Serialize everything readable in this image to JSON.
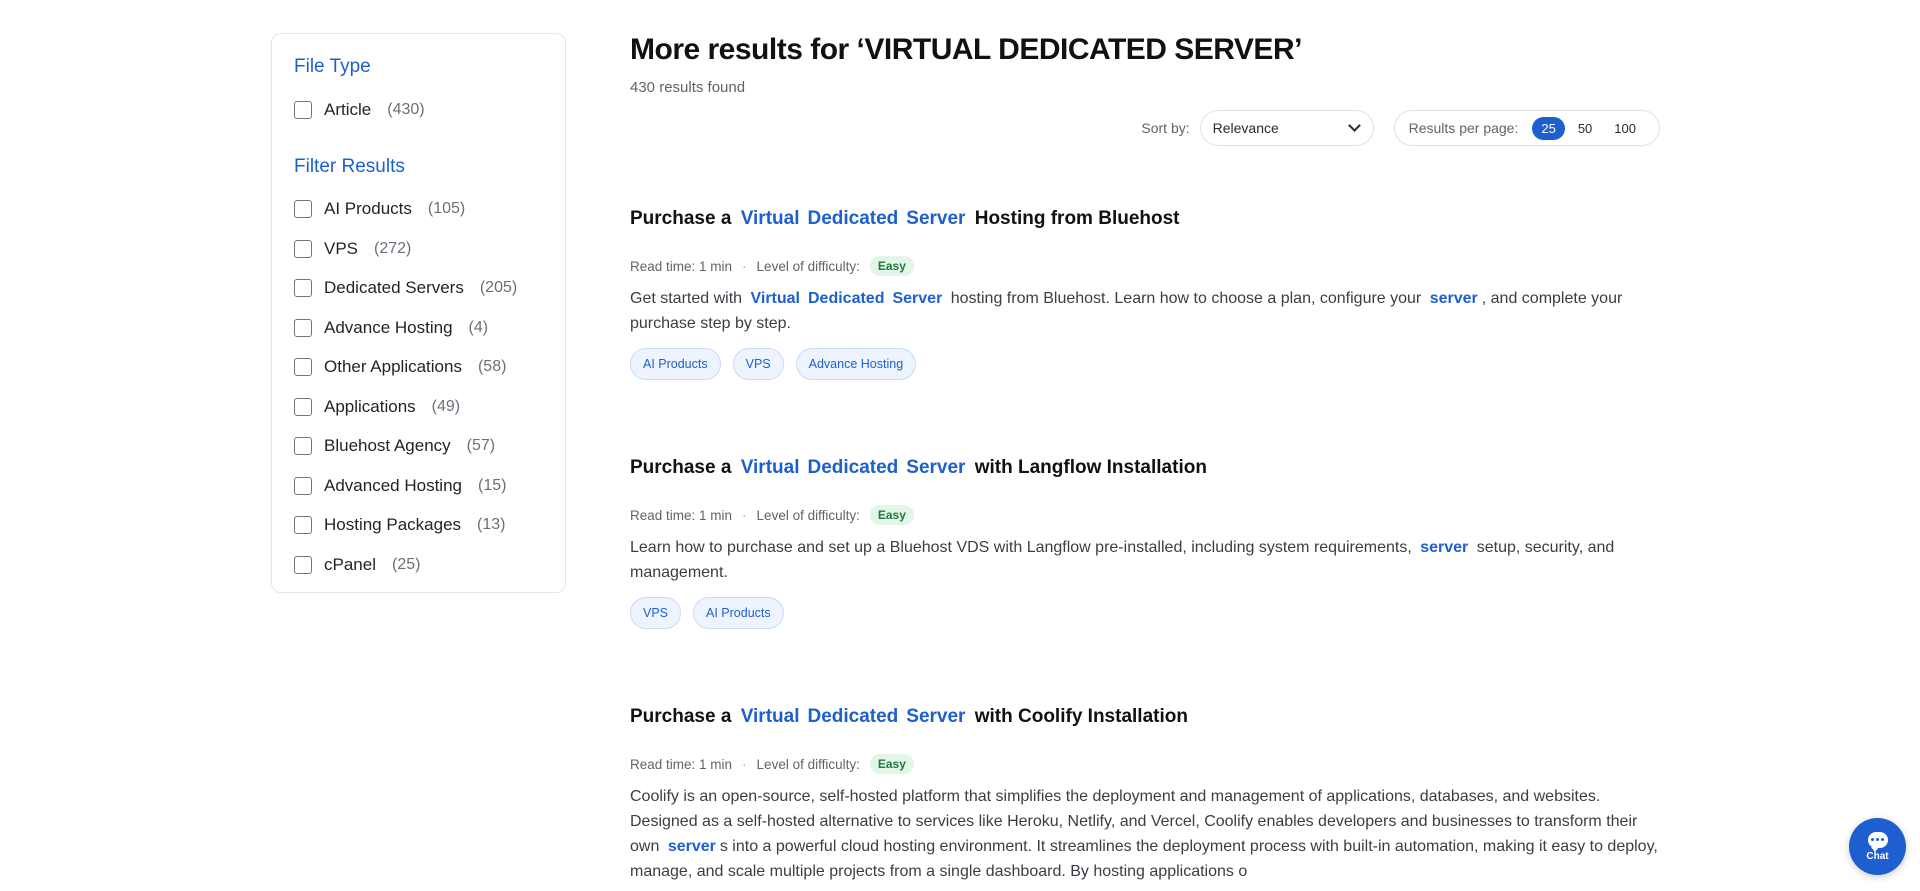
{
  "sidebar": {
    "file_type_title": "File Type",
    "file_type": [
      {
        "label": "Article",
        "count": "(430)"
      }
    ],
    "filter_title": "Filter Results",
    "filters": [
      {
        "label": "AI Products",
        "count": "(105)"
      },
      {
        "label": "VPS",
        "count": "(272)"
      },
      {
        "label": "Dedicated Servers",
        "count": "(205)"
      },
      {
        "label": "Advance Hosting",
        "count": "(4)"
      },
      {
        "label": "Other Applications",
        "count": "(58)"
      },
      {
        "label": "Applications",
        "count": "(49)"
      },
      {
        "label": "Bluehost Agency",
        "count": "(57)"
      },
      {
        "label": "Advanced Hosting",
        "count": "(15)"
      },
      {
        "label": "Hosting Packages",
        "count": "(13)"
      },
      {
        "label": "cPanel",
        "count": "(25)"
      }
    ]
  },
  "header": {
    "title": "More results for ‘VIRTUAL DEDICATED SERVER’",
    "count": "430 results found"
  },
  "controls": {
    "sort_label": "Sort by:",
    "sort_value": "Relevance",
    "per_page_label": "Results per page:",
    "per_page_options": [
      "25",
      "50",
      "100"
    ],
    "per_page_selected": "25"
  },
  "results": [
    {
      "title_prefix": "Purchase a",
      "title_hl": [
        "Virtual",
        "Dedicated",
        "Server"
      ],
      "title_suffix": "Hosting from Bluehost",
      "read_time": "Read time: 1 min",
      "difficulty_label": "Level of difficulty:",
      "difficulty": "Easy",
      "desc_1": "Get started with",
      "desc_hl": [
        "Virtual",
        "Dedicated",
        "Server"
      ],
      "desc_2": "hosting from Bluehost. Learn how to choose a plan, configure your",
      "desc_hl2": "server",
      "desc_3": ", and complete your purchase step by step.",
      "tags": [
        "AI Products",
        "VPS",
        "Advance Hosting"
      ]
    },
    {
      "title_prefix": "Purchase a",
      "title_hl": [
        "Virtual",
        "Dedicated",
        "Server"
      ],
      "title_suffix": "with Langflow Installation",
      "read_time": "Read time: 1 min",
      "difficulty_label": "Level of difficulty:",
      "difficulty": "Easy",
      "desc_1": "Learn how to purchase and set up a Bluehost VDS with Langflow pre-installed, including system requirements,",
      "desc_hl2": "server",
      "desc_3": "setup, security, and management.",
      "tags": [
        "VPS",
        "AI Products"
      ]
    },
    {
      "title_prefix": "Purchase a",
      "title_hl": [
        "Virtual",
        "Dedicated",
        "Server"
      ],
      "title_suffix": "with Coolify Installation",
      "read_time": "Read time: 1 min",
      "difficulty_label": "Level of difficulty:",
      "difficulty": "Easy",
      "desc_1": "Coolify is an open-source, self-hosted platform that simplifies the deployment and management of applications, databases, and websites. Designed as a self-hosted alternative to services like Heroku, Netlify, and Vercel, Coolify enables developers and businesses to transform their own",
      "desc_hl2": "server",
      "desc_3": "s into a powerful cloud hosting environment. It streamlines the deployment process with built-in automation, making it easy to deploy, manage, and scale multiple projects from a single dashboard. By hosting applications o"
    }
  ],
  "chat": {
    "label": "Chat",
    "icon": "chat-bubble-icon"
  },
  "colors": {
    "accent": "#1e5fd0",
    "easy_badge": "#e3f5e8"
  }
}
